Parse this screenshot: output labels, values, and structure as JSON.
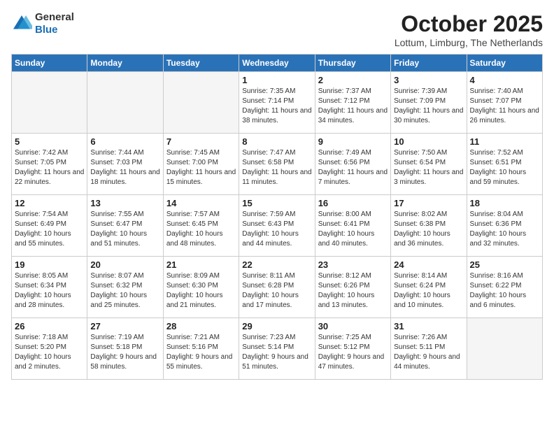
{
  "logo": {
    "general": "General",
    "blue": "Blue"
  },
  "title": "October 2025",
  "location": "Lottum, Limburg, The Netherlands",
  "days_of_week": [
    "Sunday",
    "Monday",
    "Tuesday",
    "Wednesday",
    "Thursday",
    "Friday",
    "Saturday"
  ],
  "weeks": [
    [
      {
        "day": "",
        "info": ""
      },
      {
        "day": "",
        "info": ""
      },
      {
        "day": "",
        "info": ""
      },
      {
        "day": "1",
        "info": "Sunrise: 7:35 AM\nSunset: 7:14 PM\nDaylight: 11 hours and 38 minutes."
      },
      {
        "day": "2",
        "info": "Sunrise: 7:37 AM\nSunset: 7:12 PM\nDaylight: 11 hours and 34 minutes."
      },
      {
        "day": "3",
        "info": "Sunrise: 7:39 AM\nSunset: 7:09 PM\nDaylight: 11 hours and 30 minutes."
      },
      {
        "day": "4",
        "info": "Sunrise: 7:40 AM\nSunset: 7:07 PM\nDaylight: 11 hours and 26 minutes."
      }
    ],
    [
      {
        "day": "5",
        "info": "Sunrise: 7:42 AM\nSunset: 7:05 PM\nDaylight: 11 hours and 22 minutes."
      },
      {
        "day": "6",
        "info": "Sunrise: 7:44 AM\nSunset: 7:03 PM\nDaylight: 11 hours and 18 minutes."
      },
      {
        "day": "7",
        "info": "Sunrise: 7:45 AM\nSunset: 7:00 PM\nDaylight: 11 hours and 15 minutes."
      },
      {
        "day": "8",
        "info": "Sunrise: 7:47 AM\nSunset: 6:58 PM\nDaylight: 11 hours and 11 minutes."
      },
      {
        "day": "9",
        "info": "Sunrise: 7:49 AM\nSunset: 6:56 PM\nDaylight: 11 hours and 7 minutes."
      },
      {
        "day": "10",
        "info": "Sunrise: 7:50 AM\nSunset: 6:54 PM\nDaylight: 11 hours and 3 minutes."
      },
      {
        "day": "11",
        "info": "Sunrise: 7:52 AM\nSunset: 6:51 PM\nDaylight: 10 hours and 59 minutes."
      }
    ],
    [
      {
        "day": "12",
        "info": "Sunrise: 7:54 AM\nSunset: 6:49 PM\nDaylight: 10 hours and 55 minutes."
      },
      {
        "day": "13",
        "info": "Sunrise: 7:55 AM\nSunset: 6:47 PM\nDaylight: 10 hours and 51 minutes."
      },
      {
        "day": "14",
        "info": "Sunrise: 7:57 AM\nSunset: 6:45 PM\nDaylight: 10 hours and 48 minutes."
      },
      {
        "day": "15",
        "info": "Sunrise: 7:59 AM\nSunset: 6:43 PM\nDaylight: 10 hours and 44 minutes."
      },
      {
        "day": "16",
        "info": "Sunrise: 8:00 AM\nSunset: 6:41 PM\nDaylight: 10 hours and 40 minutes."
      },
      {
        "day": "17",
        "info": "Sunrise: 8:02 AM\nSunset: 6:38 PM\nDaylight: 10 hours and 36 minutes."
      },
      {
        "day": "18",
        "info": "Sunrise: 8:04 AM\nSunset: 6:36 PM\nDaylight: 10 hours and 32 minutes."
      }
    ],
    [
      {
        "day": "19",
        "info": "Sunrise: 8:05 AM\nSunset: 6:34 PM\nDaylight: 10 hours and 28 minutes."
      },
      {
        "day": "20",
        "info": "Sunrise: 8:07 AM\nSunset: 6:32 PM\nDaylight: 10 hours and 25 minutes."
      },
      {
        "day": "21",
        "info": "Sunrise: 8:09 AM\nSunset: 6:30 PM\nDaylight: 10 hours and 21 minutes."
      },
      {
        "day": "22",
        "info": "Sunrise: 8:11 AM\nSunset: 6:28 PM\nDaylight: 10 hours and 17 minutes."
      },
      {
        "day": "23",
        "info": "Sunrise: 8:12 AM\nSunset: 6:26 PM\nDaylight: 10 hours and 13 minutes."
      },
      {
        "day": "24",
        "info": "Sunrise: 8:14 AM\nSunset: 6:24 PM\nDaylight: 10 hours and 10 minutes."
      },
      {
        "day": "25",
        "info": "Sunrise: 8:16 AM\nSunset: 6:22 PM\nDaylight: 10 hours and 6 minutes."
      }
    ],
    [
      {
        "day": "26",
        "info": "Sunrise: 7:18 AM\nSunset: 5:20 PM\nDaylight: 10 hours and 2 minutes."
      },
      {
        "day": "27",
        "info": "Sunrise: 7:19 AM\nSunset: 5:18 PM\nDaylight: 9 hours and 58 minutes."
      },
      {
        "day": "28",
        "info": "Sunrise: 7:21 AM\nSunset: 5:16 PM\nDaylight: 9 hours and 55 minutes."
      },
      {
        "day": "29",
        "info": "Sunrise: 7:23 AM\nSunset: 5:14 PM\nDaylight: 9 hours and 51 minutes."
      },
      {
        "day": "30",
        "info": "Sunrise: 7:25 AM\nSunset: 5:12 PM\nDaylight: 9 hours and 47 minutes."
      },
      {
        "day": "31",
        "info": "Sunrise: 7:26 AM\nSunset: 5:11 PM\nDaylight: 9 hours and 44 minutes."
      },
      {
        "day": "",
        "info": ""
      }
    ]
  ]
}
